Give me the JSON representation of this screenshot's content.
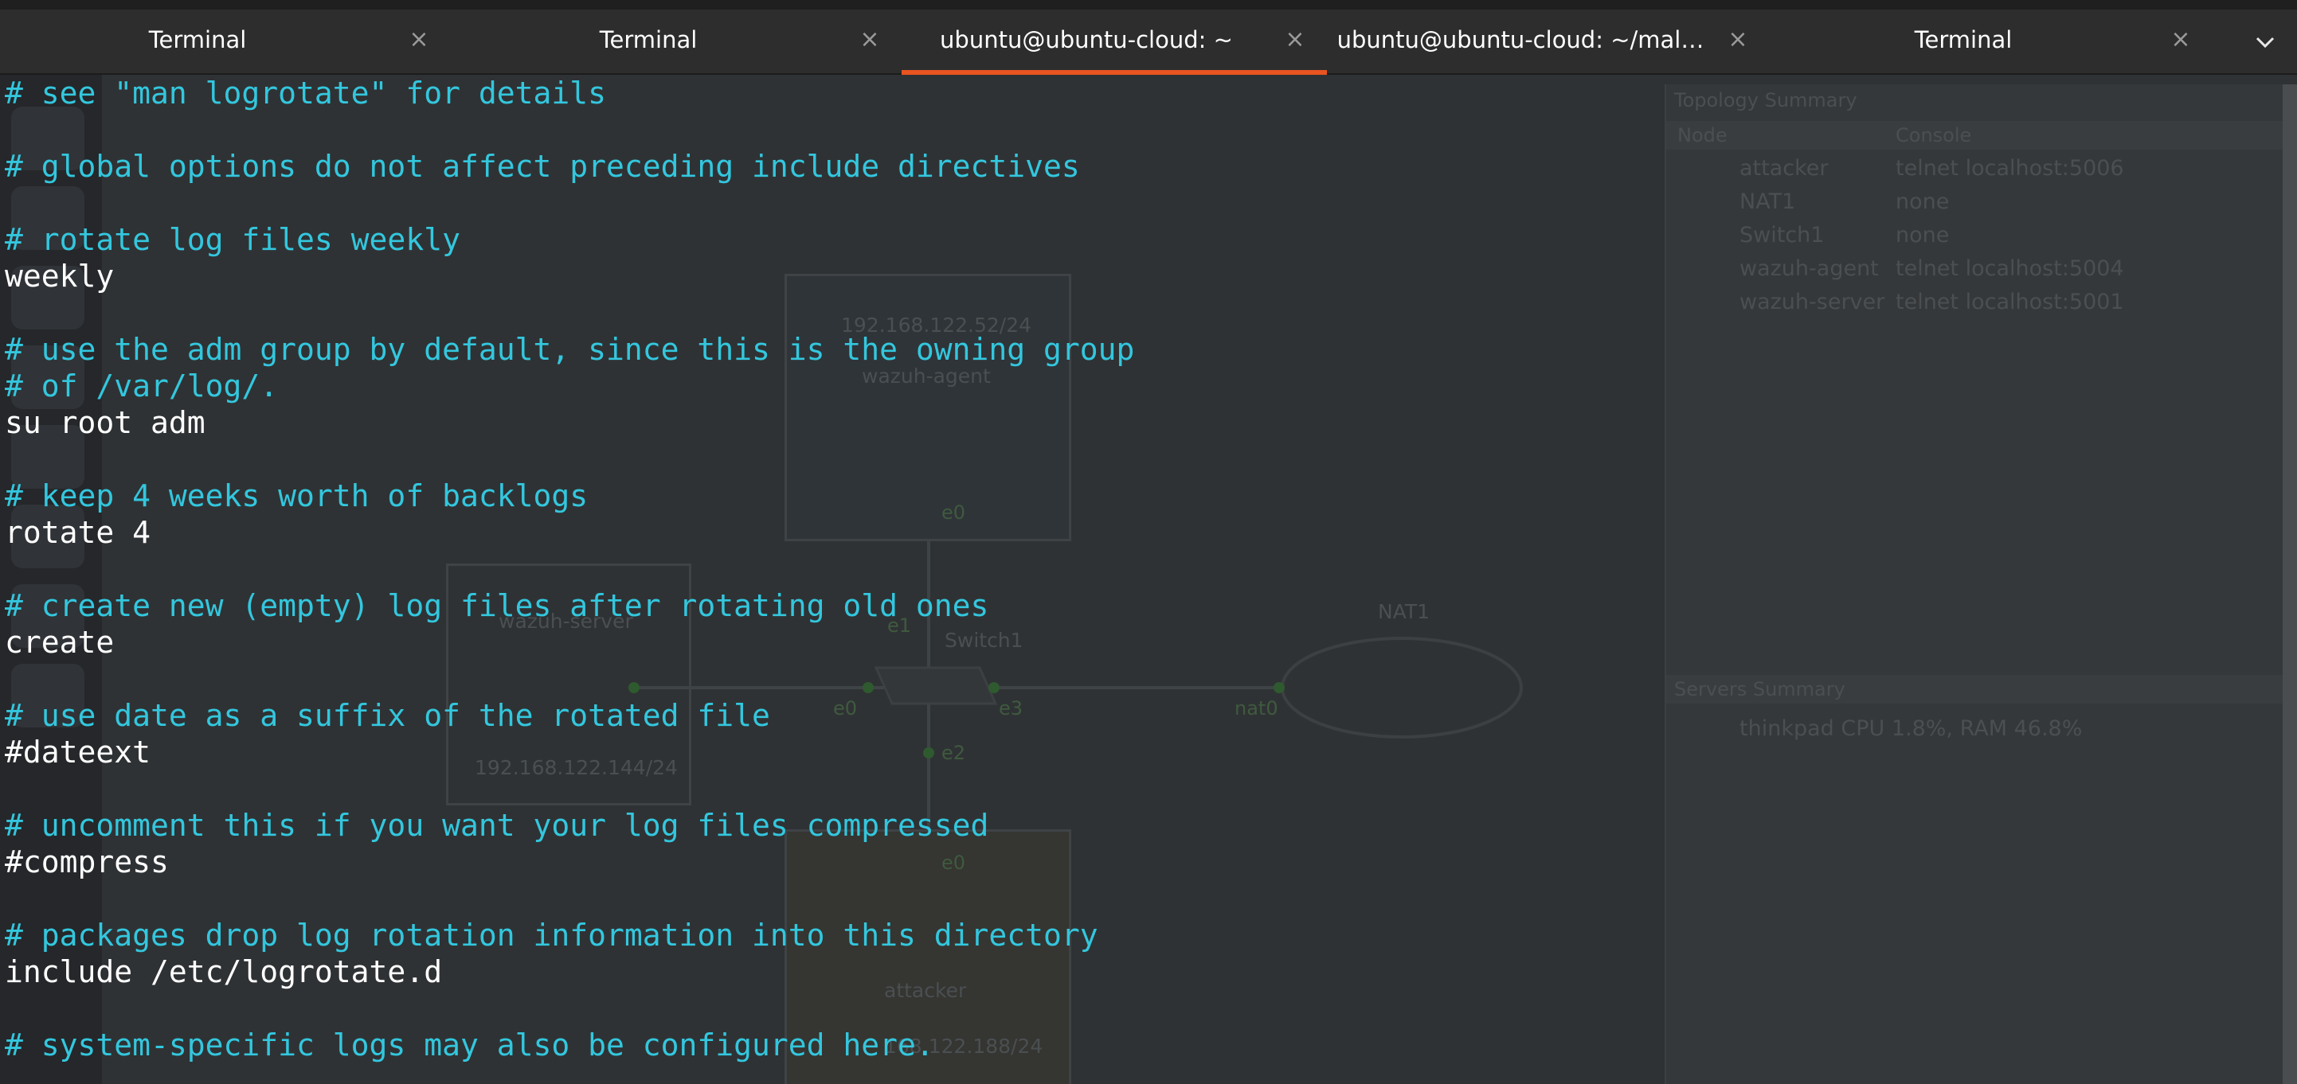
{
  "tabs": [
    {
      "title": "Terminal",
      "active": false
    },
    {
      "title": "Terminal",
      "active": false
    },
    {
      "title": "ubuntu@ubuntu-cloud: ~",
      "active": true
    },
    {
      "title": "ubuntu@ubuntu-cloud: ~/mal…",
      "active": false
    },
    {
      "title": "Terminal",
      "active": false
    }
  ],
  "tab_close_glyph": "×",
  "tab_menu_icon": "chevron-down-icon",
  "colors": {
    "comment": "#33c7de",
    "text": "#ffffff",
    "accent": "#e95420",
    "background": "#2f3234"
  },
  "file_lines": [
    {
      "text": "# see \"man logrotate\" for details",
      "kind": "comment"
    },
    {
      "text": "# global options do not affect preceding include directives",
      "kind": "comment"
    },
    {
      "text": "# rotate log files weekly",
      "kind": "comment"
    },
    {
      "text": "weekly",
      "kind": "plain"
    },
    {
      "text": "# use the adm group by default, since this is the owning group",
      "kind": "comment"
    },
    {
      "text": "# of /var/log/.",
      "kind": "comment"
    },
    {
      "text": "su root adm",
      "kind": "plain"
    },
    {
      "text": "# keep 4 weeks worth of backlogs",
      "kind": "comment"
    },
    {
      "text": "rotate 4",
      "kind": "plain"
    },
    {
      "text": "# create new (empty) log files after rotating old ones",
      "kind": "comment"
    },
    {
      "text": "create",
      "kind": "plain"
    },
    {
      "text": "# use date as a suffix of the rotated file",
      "kind": "comment"
    },
    {
      "text": "#dateext",
      "kind": "plain"
    },
    {
      "text": "# uncomment this if you want your log files compressed",
      "kind": "comment"
    },
    {
      "text": "#compress",
      "kind": "plain"
    },
    {
      "text": "# packages drop log rotation information into this directory",
      "kind": "comment"
    },
    {
      "text": "include /etc/logrotate.d",
      "kind": "plain"
    },
    {
      "text": "# system-specific logs may also be configured here.",
      "kind": "comment"
    }
  ],
  "background_app": {
    "topology_summary": {
      "title": "Topology Summary",
      "columns": [
        "Node",
        "Console"
      ],
      "rows": [
        {
          "node": "attacker",
          "console": "telnet localhost:5006"
        },
        {
          "node": "NAT1",
          "console": "none"
        },
        {
          "node": "Switch1",
          "console": "none"
        },
        {
          "node": "wazuh-agent",
          "console": "telnet localhost:5004"
        },
        {
          "node": "wazuh-server",
          "console": "telnet localhost:5001"
        }
      ]
    },
    "servers_summary": {
      "title": "Servers Summary",
      "row": "thinkpad CPU 1.8%, RAM 46.8%"
    },
    "nodes": {
      "agent_ip": "192.168.122.52/24",
      "agent_name": "wazuh-agent",
      "server_name": "wazuh-server",
      "server_ip": "192.168.122.144/24",
      "attacker_name": "attacker",
      "attacker_ip": "168.122.188/24",
      "switch_name": "Switch1",
      "nat_name": "NAT1"
    },
    "ports": {
      "e0_top": "e0",
      "e1": "e1",
      "e0_left": "e0",
      "e3": "e3",
      "e2": "e2",
      "e0_bottom": "e0",
      "nat0": "nat0"
    }
  }
}
